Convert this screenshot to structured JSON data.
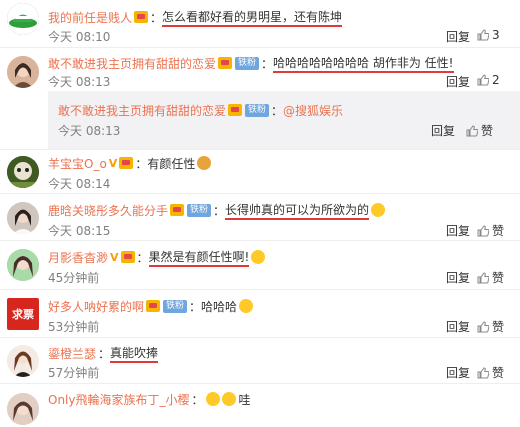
{
  "comments": [
    {
      "user": "我的前任是贱人",
      "text": "怎么看都好看的男明星，还有陈坤",
      "time": "今天 08:10",
      "reply": "回复",
      "likes": "3",
      "fan": "",
      "vip": ""
    },
    {
      "user": "敢不敢进我主页拥有甜甜的恋爱",
      "text": "哈哈哈哈哈哈哈哈 胡作非为 任性!",
      "time": "今天 08:13",
      "reply": "回复",
      "likes": "2",
      "fan": "铁粉",
      "vip": ""
    },
    {
      "user": "敢不敢进我主页拥有甜甜的恋爱",
      "text": "@搜狐娱乐",
      "time": "今天 08:13",
      "reply": "回复",
      "likes": "赞",
      "fan": "铁粉",
      "vip": ""
    },
    {
      "user": "羊宝宝O_o",
      "text": "有颜任性",
      "time": "今天 08:14",
      "reply": "回复",
      "likes": "赞",
      "fan": "",
      "vip": "V"
    },
    {
      "user": "鹿晗关晓彤多久能分手",
      "text": "长得帅真的可以为所欲为的",
      "time": "今天 08:15",
      "reply": "回复",
      "likes": "赞",
      "fan": "铁粉",
      "vip": ""
    },
    {
      "user": "月影香杳渺",
      "text": "果然是有颜任性啊!",
      "time": "45分钟前",
      "reply": "回复",
      "likes": "赞",
      "fan": "",
      "vip": "V"
    },
    {
      "user": "好多人呐好累的啊",
      "text": "哈哈哈",
      "time": "53分钟前",
      "reply": "回复",
      "likes": "赞",
      "fan": "铁粉",
      "vip": ""
    },
    {
      "user": "鎏橙兰瑟",
      "text": "真能吹捧",
      "time": "57分钟前",
      "reply": "回复",
      "likes": "赞",
      "fan": "",
      "vip": ""
    },
    {
      "user": "Only飛輪海家族布丁_小樱",
      "text": "哇",
      "time": "",
      "reply": "",
      "likes": "",
      "fan": "",
      "vip": ""
    }
  ],
  "colors": {
    "username": "#eb7350",
    "underline": "#e4393c",
    "time": "#808080"
  },
  "avatar_label": "求票"
}
